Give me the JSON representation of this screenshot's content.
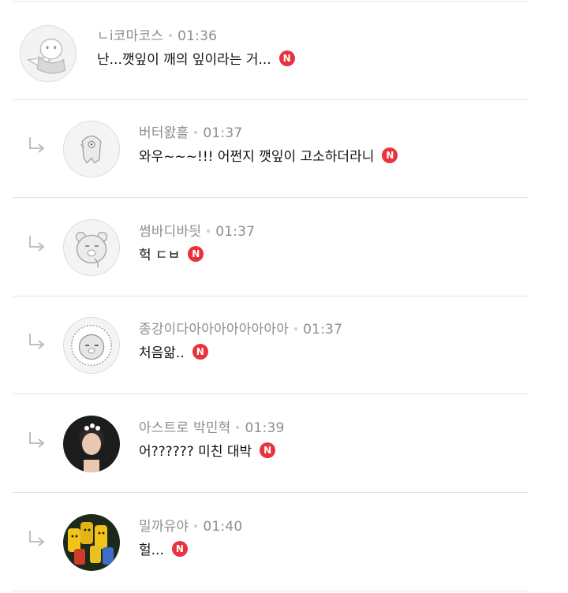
{
  "badge_label": "N",
  "colors": {
    "new_badge": "#e8323c",
    "meta_text": "#8e8e8e",
    "body_text": "#111111",
    "divider": "#e4e4e4"
  },
  "comments": [
    {
      "author": "ㄴi코마코스",
      "time": "01:36",
      "text": "난...깻잎이 깨의 잎이라는 거...",
      "is_reply": false,
      "avatar_icon": "character-avatar-icon",
      "is_new": true
    },
    {
      "author": "버터왌흘",
      "time": "01:37",
      "text": "와우~~~!!! 어쩐지 깻잎이 고소하더라니",
      "is_reply": true,
      "avatar_icon": "character-avatar-icon",
      "is_new": true
    },
    {
      "author": "썸바디바딋",
      "time": "01:37",
      "text": "헉 ㄷㅂ",
      "is_reply": true,
      "avatar_icon": "bear-avatar-icon",
      "is_new": true
    },
    {
      "author": "종강이다아아아아아아아아",
      "time": "01:37",
      "text": "처음앎..",
      "is_reply": true,
      "avatar_icon": "lion-avatar-icon",
      "is_new": true
    },
    {
      "author": "아스트로 박민혁",
      "time": "01:39",
      "text": "어?????? 미친 대박",
      "is_reply": true,
      "avatar_icon": "person-photo-avatar",
      "is_new": true
    },
    {
      "author": "밀까유야",
      "time": "01:40",
      "text": "헐...",
      "is_reply": true,
      "avatar_icon": "group-photo-avatar",
      "is_new": true
    }
  ]
}
